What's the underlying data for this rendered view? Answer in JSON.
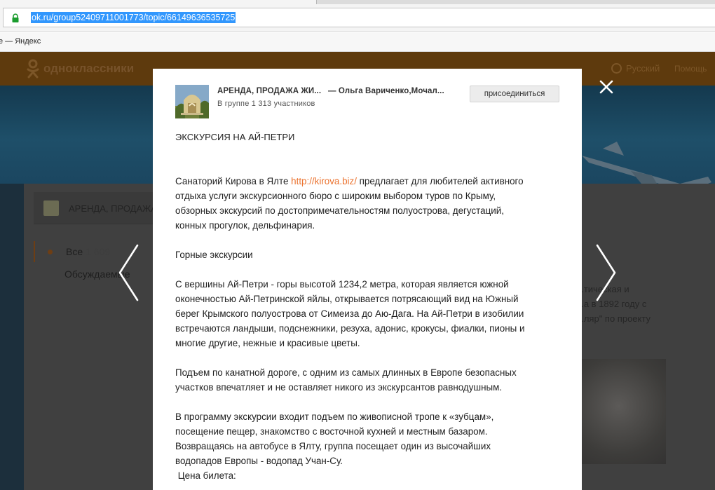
{
  "browser": {
    "url": "ok.ru/group52409711001773/topic/66149636535725",
    "bookmark": "е — Яндекс"
  },
  "site": {
    "logo_text": "одноклассники",
    "language": "Русский",
    "help": "Помощь",
    "group_name": "АРЕНДА, ПРОДАЖА",
    "sidebar": [
      {
        "label": "Все",
        "count": "1 609"
      },
      {
        "label": "Обсуждаемые",
        "count": ""
      }
    ],
    "bg_text": [
      "...тическая и",
      "...а в 1892 году с",
      "...ляр\" по проекту"
    ]
  },
  "modal": {
    "group_title": "АРЕНДА, ПРОДАЖА ЖИ...",
    "author": "— Ольга Вариченко,Мочал...",
    "members": "В группе 1 313 участников",
    "join_label": "присоединиться",
    "topic_title": "ЭКСКУРСИЯ НА АЙ-ПЕТРИ",
    "p1": {
      "before_link": "Санаторий Кирова в Ялте ",
      "link": "http://kirova.biz/",
      "after_link": " предлагает для любителей активного",
      "lines": [
        "отдыха услуги экскурсионного бюро с широким выбором туров по Крыму,",
        "обзорных экскурсий по достопримечательностям полуострова, дегустаций,",
        "конных прогулок, дельфинария."
      ]
    },
    "heading2": "Горные экскурсии",
    "p2": [
      "С вершины Ай-Петри - горы высотой 1234,2 метра, которая является южной",
      "оконечностью Ай-Петринской яйлы, открывается потрясающий вид на Южный",
      "берег Крымского полуострова от Симеиза до Аю-Дага. На Ай-Петри в изобилии",
      "встречаются ландыши, подснежники, резуха, адонис, крокусы, фиалки, пионы и",
      "многие другие, нежные и красивые цветы."
    ],
    "p3": [
      "Подъем по канатной дороге, с одним из самых длинных в Европе безопасных",
      "участков впечатляет и не оставляет никого из экскурсантов равнодушным."
    ],
    "p4": [
      "В программу экскурсии входит подъем по живописной тропе к «зубцам»,",
      "посещение пещер, знакомство с восточной кухней и местным базаром.",
      "Возвращаясь на автобусе в Ялту, группа посещает один из высочайших",
      "водопадов Европы - водопад Учан-Су."
    ],
    "price_label": " Цена билета:"
  },
  "colors": {
    "link": "#eb722e",
    "url_highlight": "#3297fd",
    "lock": "#1a9c2e",
    "ok_orange": "#ee8208"
  },
  "icons": [
    "lock-icon",
    "ok-logo-icon",
    "globe-icon",
    "close-icon",
    "chevron-left-icon",
    "chevron-right-icon"
  ]
}
